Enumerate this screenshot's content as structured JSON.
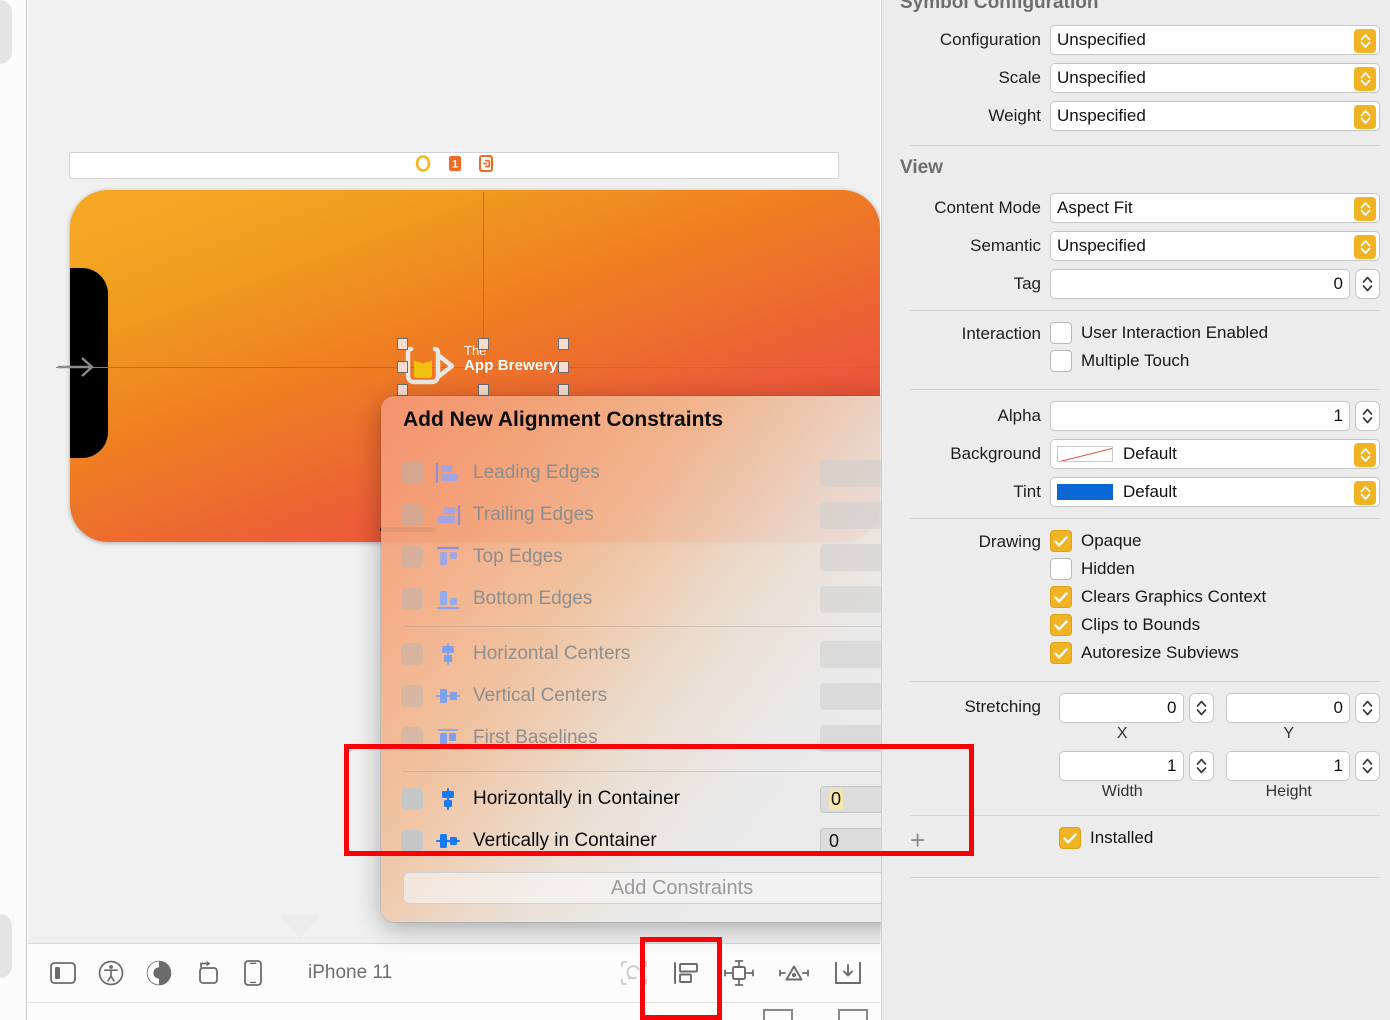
{
  "canvas": {
    "scene_dock": {
      "icons": [
        "view-controller-icon",
        "first-responder-icon",
        "exit-segue-icon"
      ]
    },
    "device_label": "iPhone 11",
    "logo": {
      "line1": "The",
      "line2": "App Brewery"
    },
    "entry_arrow": "storyboard-entry-point-arrow",
    "gradient": {
      "from": "#f5a623",
      "to": "#e8453f"
    },
    "guide_color": "#4a88c7"
  },
  "toolbar": {
    "left_buttons": [
      {
        "name": "show-document-outline-button",
        "icon": "sidebar-icon"
      },
      {
        "name": "accessibility-inspector-button",
        "icon": "accessibility-icon"
      },
      {
        "name": "appearance-variants-button",
        "icon": "contrast-circle-icon"
      },
      {
        "name": "orientation-button",
        "icon": "rotate-device-icon"
      },
      {
        "name": "device-button",
        "icon": "iphone-icon"
      }
    ],
    "device_name": "iPhone 11",
    "right_buttons": [
      {
        "name": "update-frames-button",
        "icon": "update-frames-icon",
        "disabled": true
      },
      {
        "name": "align-button",
        "icon": "align-icon",
        "highlighted": true
      },
      {
        "name": "add-new-constraints-button",
        "icon": "pin-constraints-icon"
      },
      {
        "name": "resolve-auto-layout-issues-button",
        "icon": "resolve-issues-icon"
      },
      {
        "name": "embed-in-button",
        "icon": "embed-in-icon"
      }
    ]
  },
  "popover": {
    "title": "Add New Alignment Constraints",
    "rows": [
      {
        "label": "Leading Edges",
        "icon": "align-leading-edges-icon",
        "checked": false,
        "enabled": false,
        "value": "",
        "highlighted": false
      },
      {
        "label": "Trailing Edges",
        "icon": "align-trailing-edges-icon",
        "checked": false,
        "enabled": false,
        "value": "",
        "highlighted": false
      },
      {
        "label": "Top Edges",
        "icon": "align-top-edges-icon",
        "checked": false,
        "enabled": false,
        "value": "",
        "highlighted": false
      },
      {
        "label": "Bottom Edges",
        "icon": "align-bottom-edges-icon",
        "checked": false,
        "enabled": false,
        "value": "",
        "highlighted": false
      }
    ],
    "rows2": [
      {
        "label": "Horizontal Centers",
        "icon": "align-horizontal-centers-icon",
        "checked": false,
        "enabled": false,
        "value": "",
        "highlighted": false
      },
      {
        "label": "Vertical Centers",
        "icon": "align-vertical-centers-icon",
        "checked": false,
        "enabled": false,
        "value": "",
        "highlighted": false
      },
      {
        "label": "First Baselines",
        "icon": "align-first-baselines-icon",
        "checked": false,
        "enabled": false,
        "value": "",
        "highlighted": false
      }
    ],
    "rows3": [
      {
        "label": "Horizontally in Container",
        "icon": "center-horizontally-in-container-icon",
        "checked": false,
        "enabled": true,
        "value": "0",
        "highlighted": true
      },
      {
        "label": "Vertically in Container",
        "icon": "center-vertically-in-container-icon",
        "checked": false,
        "enabled": true,
        "value": "0",
        "highlighted": false
      }
    ],
    "add_button": "Add Constraints"
  },
  "inspector": {
    "symbol_configuration": {
      "title": "Symbol Configuration",
      "fields": [
        {
          "label": "Configuration",
          "value": "Unspecified"
        },
        {
          "label": "Scale",
          "value": "Unspecified"
        },
        {
          "label": "Weight",
          "value": "Unspecified"
        }
      ]
    },
    "view": {
      "title": "View",
      "content_mode": {
        "label": "Content Mode",
        "value": "Aspect Fit"
      },
      "semantic": {
        "label": "Semantic",
        "value": "Unspecified"
      },
      "tag": {
        "label": "Tag",
        "value": "0"
      },
      "interaction": {
        "label": "Interaction",
        "items": [
          {
            "label": "User Interaction Enabled",
            "checked": false
          },
          {
            "label": "Multiple Touch",
            "checked": false
          }
        ]
      },
      "alpha": {
        "label": "Alpha",
        "value": "1"
      },
      "background": {
        "label": "Background",
        "value": "Default",
        "swatch": "#ffffff"
      },
      "tint": {
        "label": "Tint",
        "value": "Default",
        "swatch": "#0a68d6"
      },
      "drawing": {
        "label": "Drawing",
        "items": [
          {
            "label": "Opaque",
            "checked": true
          },
          {
            "label": "Hidden",
            "checked": false
          },
          {
            "label": "Clears Graphics Context",
            "checked": true
          },
          {
            "label": "Clips to Bounds",
            "checked": true
          },
          {
            "label": "Autoresize Subviews",
            "checked": true
          }
        ]
      },
      "stretching": {
        "label": "Stretching",
        "x": {
          "caption": "X",
          "value": "0"
        },
        "y": {
          "caption": "Y",
          "value": "0"
        },
        "width": {
          "caption": "Width",
          "value": "1"
        },
        "height": {
          "caption": "Height",
          "value": "1"
        }
      },
      "installed": {
        "label": "Installed",
        "checked": true
      },
      "add_variation": "+"
    },
    "accent_yellow": "#f0b323"
  }
}
